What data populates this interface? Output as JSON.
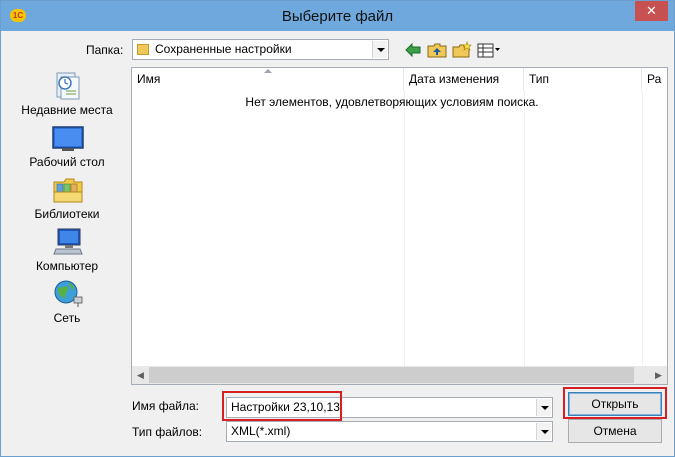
{
  "dialog": {
    "title": "Выберите файл",
    "close_glyph": "✕",
    "app_icon_text": "1С"
  },
  "toolbar": {
    "look_in_label": "Папка:",
    "look_in_value": "Сохраненные настройки",
    "icons": [
      "back-arrow-icon",
      "up-folder-icon",
      "new-folder-icon",
      "view-menu-icon"
    ]
  },
  "places": [
    {
      "label": "Недавние места",
      "icon": "recent-places-icon"
    },
    {
      "label": "Рабочий стол",
      "icon": "desktop-icon"
    },
    {
      "label": "Библиотеки",
      "icon": "libraries-icon"
    },
    {
      "label": "Компьютер",
      "icon": "computer-icon"
    },
    {
      "label": "Сеть",
      "icon": "network-icon"
    }
  ],
  "filelist": {
    "columns": [
      "Имя",
      "Дата изменения",
      "Тип",
      "Ра"
    ],
    "empty_message": "Нет элементов, удовлетворяющих условиям поиска.",
    "scroll_left_glyph": "◀",
    "scroll_right_glyph": "▶"
  },
  "form": {
    "filename_label": "Имя файла:",
    "filename_value": "Настройки 23,10,13",
    "filetype_label": "Тип файлов:",
    "filetype_value": "XML(*.xml)",
    "open_button": "Открыть",
    "cancel_button": "Отмена"
  },
  "colors": {
    "titlebar": "#6fa8dc",
    "close_button": "#c75050",
    "highlight": "#d62024"
  }
}
